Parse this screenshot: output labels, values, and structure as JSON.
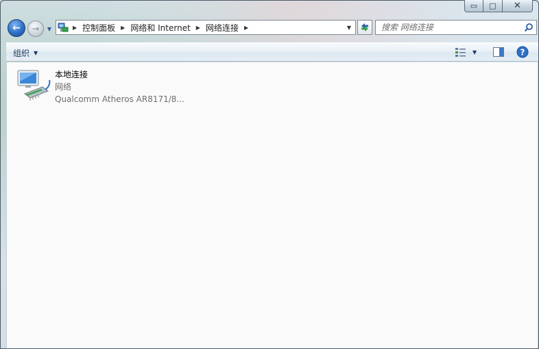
{
  "window": {
    "caption": {
      "minimize_glyph": "▭",
      "maximize_glyph": "□",
      "close_glyph": "✕"
    }
  },
  "nav": {
    "back_glyph": "←",
    "forward_glyph": "→",
    "history_glyph": "▼"
  },
  "address": {
    "breadcrumbs": [
      "控制面板",
      "网络和 Internet",
      "网络连接"
    ],
    "separator_glyph": "▶",
    "dropdown_glyph": "▼"
  },
  "search": {
    "placeholder": "搜索 网络连接"
  },
  "toolbar": {
    "organize_label": "组织",
    "caret_glyph": "▼"
  },
  "items": [
    {
      "name": "本地连接",
      "status": "网络",
      "device": "Qualcomm Atheros AR8171/8..."
    }
  ],
  "icons": {
    "address_icon": "network-folder-icon",
    "refresh_icon": "refresh-icon",
    "search_icon": "search-icon",
    "views_icon": "change-view-icon",
    "preview_icon": "preview-pane-icon",
    "help_icon": "help-icon",
    "connection_icon": "network-adapter-icon"
  },
  "colors": {
    "accent": "#2d6fc6",
    "toolbar_text": "#1e395b",
    "secondary_text": "#6d6d6d"
  }
}
